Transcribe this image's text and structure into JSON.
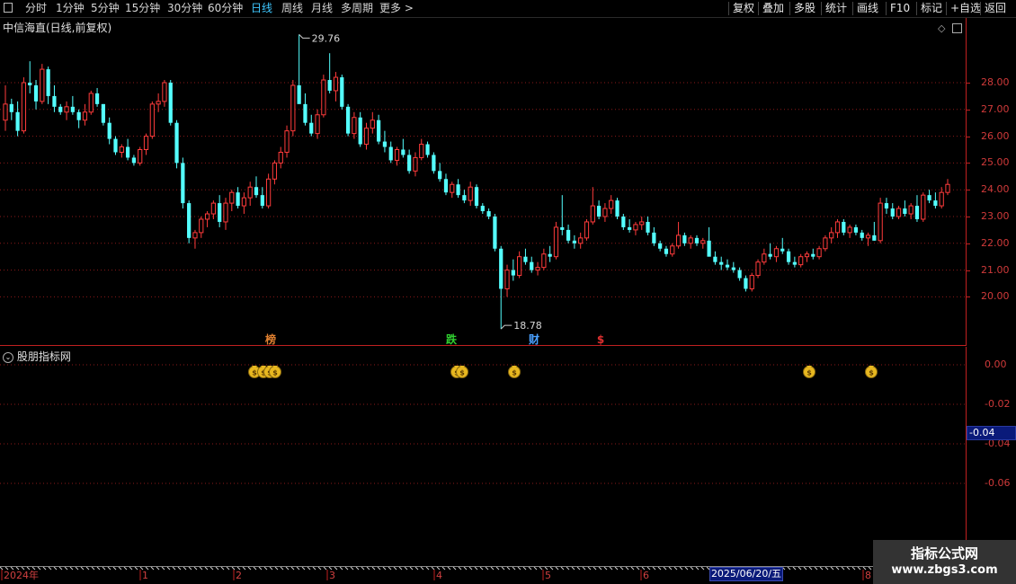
{
  "toolbar": {
    "periods": [
      "分时",
      "1分钟",
      "5分钟",
      "15分钟",
      "30分钟",
      "60分钟",
      "日线",
      "周线",
      "月线",
      "多周期",
      "更多 >"
    ],
    "active": "日线",
    "right": [
      "复权",
      "叠加",
      "多股",
      "统计",
      "画线",
      "F10",
      "标记",
      "+自选",
      "返回"
    ]
  },
  "main_title": "中信海直(日线,前复权)",
  "price_axis": [
    "28.00",
    "27.00",
    "26.00",
    "25.00",
    "24.00",
    "23.00",
    "22.00",
    "21.00",
    "20.00"
  ],
  "annotations": {
    "high": "29.76",
    "low": "18.78"
  },
  "markers": [
    {
      "text": "榜",
      "color": "#e08030"
    },
    {
      "text": "跌",
      "color": "#30d030"
    },
    {
      "text": "财",
      "color": "#4aa0ff"
    },
    {
      "text": "$",
      "color": "#e03030"
    }
  ],
  "indicator_title": "股朋指标网",
  "indicator_axis": [
    "0.00",
    "-0.02",
    "-0.04",
    "-0.06"
  ],
  "indicator_current": "-0.04",
  "x_axis": [
    "2024年",
    "1",
    "2",
    "3",
    "4",
    "5",
    "6",
    "8"
  ],
  "cursor_date": "2025/06/20/五",
  "watermark": {
    "line1": "指标公式网",
    "line2": "www.zbgs3.com"
  },
  "colors": {
    "up": "#ff3b3b",
    "down": "#54ffff",
    "grid": "#8b1a1a",
    "axis": "#c02020"
  },
  "candles": [
    [
      26.6,
      27.9,
      26.2,
      27.2
    ],
    [
      27.2,
      27.4,
      26.6,
      26.9
    ],
    [
      26.9,
      27.3,
      26.0,
      26.2
    ],
    [
      26.2,
      28.2,
      26.1,
      28.0
    ],
    [
      28.0,
      28.8,
      27.6,
      27.9
    ],
    [
      27.9,
      28.1,
      27.0,
      27.3
    ],
    [
      27.3,
      28.7,
      27.2,
      28.5
    ],
    [
      28.5,
      28.6,
      27.2,
      27.5
    ],
    [
      27.5,
      27.9,
      26.9,
      27.1
    ],
    [
      27.1,
      27.2,
      26.8,
      26.9
    ],
    [
      26.9,
      27.3,
      26.6,
      27.1
    ],
    [
      27.1,
      27.5,
      26.8,
      26.9
    ],
    [
      26.9,
      27.0,
      26.3,
      26.6
    ],
    [
      26.6,
      27.2,
      26.4,
      26.9
    ],
    [
      26.9,
      27.7,
      26.8,
      27.6
    ],
    [
      27.6,
      27.8,
      27.1,
      27.2
    ],
    [
      27.2,
      27.2,
      26.4,
      26.5
    ],
    [
      26.5,
      26.7,
      25.7,
      25.9
    ],
    [
      25.9,
      26.0,
      25.3,
      25.4
    ],
    [
      25.4,
      25.7,
      25.2,
      25.6
    ],
    [
      25.6,
      25.9,
      25.1,
      25.2
    ],
    [
      25.2,
      25.3,
      24.9,
      25.0
    ],
    [
      25.0,
      25.6,
      24.9,
      25.5
    ],
    [
      25.5,
      26.1,
      25.3,
      26.0
    ],
    [
      26.0,
      27.3,
      25.9,
      27.2
    ],
    [
      27.2,
      27.6,
      26.9,
      27.3
    ],
    [
      27.3,
      28.1,
      27.1,
      28.0
    ],
    [
      28.0,
      28.1,
      26.4,
      26.5
    ],
    [
      26.5,
      26.6,
      24.8,
      25.0
    ],
    [
      25.0,
      25.2,
      23.3,
      23.5
    ],
    [
      23.5,
      23.6,
      22.0,
      22.2
    ],
    [
      22.2,
      22.5,
      21.8,
      22.4
    ],
    [
      22.4,
      23.0,
      22.2,
      22.9
    ],
    [
      22.9,
      23.2,
      22.6,
      23.1
    ],
    [
      23.1,
      23.6,
      22.9,
      23.5
    ],
    [
      23.5,
      23.8,
      22.6,
      22.8
    ],
    [
      22.8,
      23.7,
      22.5,
      23.5
    ],
    [
      23.5,
      24.0,
      23.2,
      23.9
    ],
    [
      23.9,
      24.1,
      23.3,
      23.4
    ],
    [
      23.4,
      23.9,
      23.1,
      23.7
    ],
    [
      23.7,
      24.3,
      23.4,
      24.1
    ],
    [
      24.1,
      24.5,
      23.7,
      23.8
    ],
    [
      23.8,
      24.1,
      23.3,
      23.4
    ],
    [
      23.4,
      24.6,
      23.3,
      24.4
    ],
    [
      24.4,
      25.1,
      24.2,
      25.0
    ],
    [
      25.0,
      25.6,
      24.8,
      25.4
    ],
    [
      25.4,
      26.4,
      25.2,
      26.2
    ],
    [
      26.2,
      28.1,
      26.0,
      27.9
    ],
    [
      27.9,
      29.8,
      27.6,
      27.2
    ],
    [
      27.2,
      27.6,
      26.4,
      26.5
    ],
    [
      26.5,
      26.8,
      26.0,
      26.1
    ],
    [
      26.1,
      27.0,
      25.9,
      26.8
    ],
    [
      26.8,
      28.3,
      26.7,
      28.1
    ],
    [
      28.1,
      29.1,
      27.6,
      27.7
    ],
    [
      27.7,
      28.4,
      27.3,
      28.2
    ],
    [
      28.2,
      28.3,
      27.0,
      27.1
    ],
    [
      27.1,
      27.2,
      26.0,
      26.1
    ],
    [
      26.1,
      26.9,
      25.9,
      26.7
    ],
    [
      26.7,
      26.9,
      25.6,
      25.7
    ],
    [
      25.7,
      26.5,
      25.5,
      26.3
    ],
    [
      26.3,
      26.9,
      26.1,
      26.6
    ],
    [
      26.6,
      26.8,
      25.7,
      25.8
    ],
    [
      25.8,
      26.2,
      25.4,
      25.6
    ],
    [
      25.6,
      25.8,
      25.0,
      25.1
    ],
    [
      25.1,
      25.6,
      24.9,
      25.5
    ],
    [
      25.5,
      25.9,
      25.2,
      25.3
    ],
    [
      25.3,
      25.5,
      24.6,
      24.7
    ],
    [
      24.7,
      25.4,
      24.5,
      25.2
    ],
    [
      25.2,
      25.9,
      25.1,
      25.7
    ],
    [
      25.7,
      25.8,
      25.2,
      25.3
    ],
    [
      25.3,
      25.4,
      24.6,
      24.7
    ],
    [
      24.7,
      25.0,
      24.3,
      24.4
    ],
    [
      24.4,
      24.6,
      23.8,
      23.9
    ],
    [
      23.9,
      24.3,
      23.7,
      24.2
    ],
    [
      24.2,
      24.4,
      23.7,
      23.8
    ],
    [
      23.8,
      24.0,
      23.5,
      23.6
    ],
    [
      23.6,
      24.3,
      23.4,
      24.1
    ],
    [
      24.1,
      24.2,
      23.3,
      23.4
    ],
    [
      23.4,
      23.5,
      23.1,
      23.2
    ],
    [
      23.2,
      23.3,
      22.9,
      23.0
    ],
    [
      23.0,
      23.1,
      21.7,
      21.8
    ],
    [
      21.8,
      21.9,
      18.8,
      20.3
    ],
    [
      20.3,
      21.2,
      20.0,
      21.0
    ],
    [
      21.0,
      21.4,
      20.6,
      20.8
    ],
    [
      20.8,
      21.7,
      20.7,
      21.5
    ],
    [
      21.5,
      21.8,
      21.2,
      21.3
    ],
    [
      21.3,
      21.5,
      20.9,
      21.0
    ],
    [
      21.0,
      21.3,
      20.8,
      21.1
    ],
    [
      21.1,
      21.8,
      21.0,
      21.6
    ],
    [
      21.6,
      21.9,
      21.3,
      21.5
    ],
    [
      21.5,
      22.8,
      21.4,
      22.6
    ],
    [
      22.6,
      23.8,
      22.3,
      22.5
    ],
    [
      22.5,
      22.7,
      22.0,
      22.1
    ],
    [
      22.1,
      22.3,
      21.8,
      22.0
    ],
    [
      22.0,
      22.4,
      21.8,
      22.2
    ],
    [
      22.2,
      22.9,
      22.1,
      22.8
    ],
    [
      22.8,
      24.1,
      22.7,
      23.4
    ],
    [
      23.4,
      23.6,
      22.9,
      23.0
    ],
    [
      23.0,
      23.5,
      22.8,
      23.3
    ],
    [
      23.3,
      23.8,
      23.1,
      23.6
    ],
    [
      23.6,
      23.7,
      22.9,
      23.0
    ],
    [
      23.0,
      23.1,
      22.5,
      22.6
    ],
    [
      22.6,
      22.9,
      22.4,
      22.5
    ],
    [
      22.5,
      22.8,
      22.3,
      22.7
    ],
    [
      22.7,
      23.0,
      22.5,
      22.8
    ],
    [
      22.8,
      23.0,
      22.3,
      22.4
    ],
    [
      22.4,
      22.6,
      21.9,
      22.0
    ],
    [
      22.0,
      22.1,
      21.7,
      21.8
    ],
    [
      21.8,
      21.9,
      21.5,
      21.6
    ],
    [
      21.6,
      22.0,
      21.5,
      21.9
    ],
    [
      21.9,
      22.8,
      21.8,
      22.3
    ],
    [
      22.3,
      22.4,
      21.9,
      22.0
    ],
    [
      22.0,
      22.3,
      21.8,
      22.2
    ],
    [
      22.2,
      22.3,
      21.9,
      22.0
    ],
    [
      22.0,
      22.2,
      21.8,
      22.1
    ],
    [
      22.1,
      22.6,
      22.0,
      21.5
    ],
    [
      21.5,
      21.7,
      21.2,
      21.3
    ],
    [
      21.3,
      21.5,
      21.0,
      21.2
    ],
    [
      21.2,
      21.4,
      21.0,
      21.1
    ],
    [
      21.1,
      21.3,
      20.9,
      21.0
    ],
    [
      21.0,
      21.1,
      20.6,
      20.7
    ],
    [
      20.7,
      20.8,
      20.2,
      20.3
    ],
    [
      20.3,
      20.9,
      20.2,
      20.8
    ],
    [
      20.8,
      21.4,
      20.7,
      21.3
    ],
    [
      21.3,
      21.8,
      21.2,
      21.6
    ],
    [
      21.6,
      22.0,
      21.4,
      21.5
    ],
    [
      21.5,
      21.9,
      21.3,
      21.8
    ],
    [
      21.8,
      22.2,
      21.6,
      21.7
    ],
    [
      21.7,
      21.8,
      21.2,
      21.3
    ],
    [
      21.3,
      21.5,
      21.1,
      21.2
    ],
    [
      21.2,
      21.6,
      21.1,
      21.5
    ],
    [
      21.5,
      21.7,
      21.3,
      21.6
    ],
    [
      21.6,
      21.8,
      21.4,
      21.5
    ],
    [
      21.5,
      21.9,
      21.4,
      21.8
    ],
    [
      21.8,
      22.3,
      21.7,
      22.2
    ],
    [
      22.2,
      22.6,
      22.0,
      22.4
    ],
    [
      22.4,
      22.9,
      22.2,
      22.8
    ],
    [
      22.8,
      22.9,
      22.3,
      22.4
    ],
    [
      22.4,
      22.7,
      22.2,
      22.6
    ],
    [
      22.6,
      22.7,
      22.3,
      22.4
    ],
    [
      22.4,
      22.5,
      22.1,
      22.2
    ],
    [
      22.2,
      22.4,
      21.9,
      22.3
    ],
    [
      22.3,
      22.8,
      22.1,
      22.1
    ],
    [
      22.1,
      23.7,
      22.0,
      23.5
    ],
    [
      23.5,
      23.7,
      23.1,
      23.3
    ],
    [
      23.3,
      23.5,
      22.9,
      23.0
    ],
    [
      23.0,
      23.4,
      22.9,
      23.3
    ],
    [
      23.3,
      23.6,
      23.0,
      23.1
    ],
    [
      23.1,
      23.5,
      22.9,
      23.4
    ],
    [
      23.4,
      23.8,
      22.8,
      22.9
    ],
    [
      22.9,
      23.9,
      22.8,
      23.8
    ],
    [
      23.8,
      24.0,
      23.5,
      23.6
    ],
    [
      23.6,
      23.9,
      23.3,
      23.4
    ],
    [
      23.4,
      24.1,
      23.3,
      23.9
    ],
    [
      23.9,
      24.4,
      23.8,
      24.2
    ]
  ],
  "indicator_icons": [
    {
      "label": "$$$$",
      "type": "cluster"
    },
    {
      "label": "$$",
      "type": "pair"
    },
    {
      "label": "$",
      "type": "single"
    },
    {
      "label": "$",
      "type": "single"
    },
    {
      "label": "$",
      "type": "single"
    }
  ]
}
